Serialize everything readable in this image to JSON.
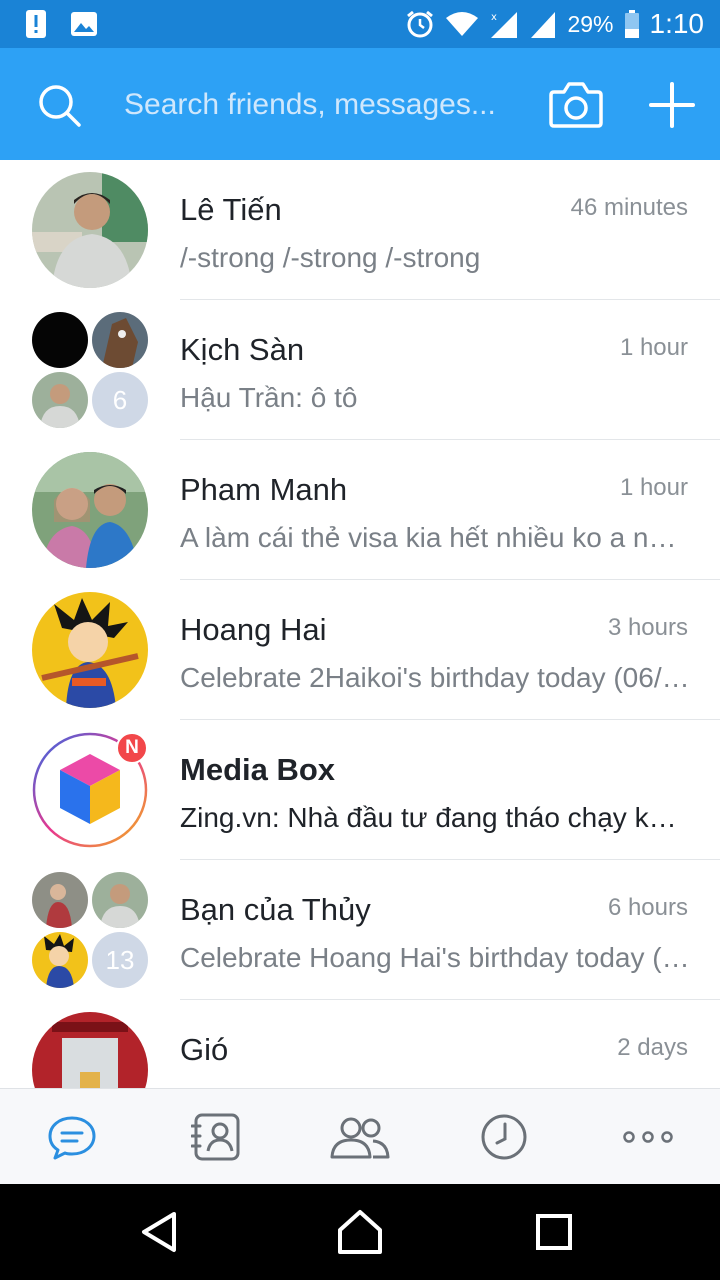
{
  "status_bar": {
    "battery": "29%",
    "time": "1:10",
    "icons": [
      "alert-icon",
      "image-icon",
      "alarm-icon",
      "wifi-icon",
      "signal-icon",
      "signal-icon",
      "battery-icon"
    ]
  },
  "header": {
    "search_placeholder": "Search friends, messages...",
    "icons": [
      "search-icon",
      "camera-icon",
      "plus-icon"
    ]
  },
  "conversations": [
    {
      "name": "Lê Tiến",
      "time": "46 minutes",
      "preview": "/-strong /-strong /-strong",
      "avatar": "single"
    },
    {
      "name": "Kịch Sàn",
      "time": "1 hour",
      "preview": "Hậu Trần: ô tô",
      "avatar": "group",
      "extra_count": "6"
    },
    {
      "name": "Pham Manh",
      "time": "1 hour",
      "preview": "A làm cái thẻ visa kia hết nhiều ko a nhờ.",
      "avatar": "single"
    },
    {
      "name": "Hoang Hai",
      "time": "3 hours",
      "preview": "Celebrate 2Haikoi's birthday today (06/…",
      "avatar": "single"
    },
    {
      "name": "Media Box",
      "time": "",
      "preview": "Zing.vn: Nhà đầu tư đang tháo chạy kh…",
      "avatar": "logo",
      "badge": "N",
      "unread": true
    },
    {
      "name": "Bạn của Thủy",
      "time": "6 hours",
      "preview": "Celebrate Hoang Hai's birthday today (…",
      "avatar": "group",
      "extra_count": "13"
    },
    {
      "name": "Gió",
      "time": "2 days",
      "preview": "",
      "avatar": "single"
    }
  ],
  "bottom_nav": [
    {
      "name": "messages",
      "icon": "chat-bubble-icon",
      "active": true
    },
    {
      "name": "contacts",
      "icon": "contacts-icon",
      "active": false
    },
    {
      "name": "groups",
      "icon": "group-icon",
      "active": false
    },
    {
      "name": "timeline",
      "icon": "clock-icon",
      "active": false
    },
    {
      "name": "more",
      "icon": "more-icon",
      "active": false
    }
  ],
  "colors": {
    "header": "#2da1f5",
    "status_bar": "#1a83d6",
    "accent": "#2b8fe0",
    "badge": "#f2474a"
  }
}
